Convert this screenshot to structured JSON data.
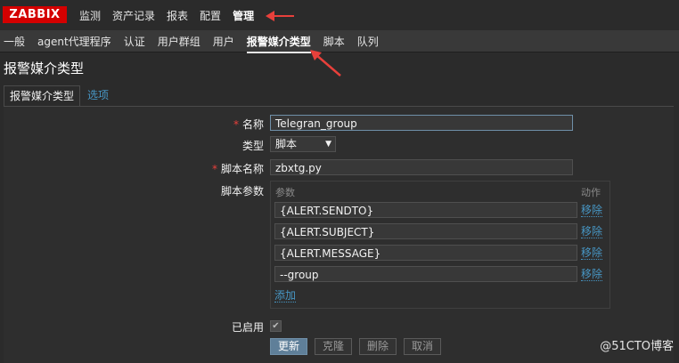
{
  "logo": "ZABBIX",
  "main_menu": [
    "监测",
    "资产记录",
    "报表",
    "配置",
    "管理"
  ],
  "sub_menu": [
    "一般",
    "agent代理程序",
    "认证",
    "用户群组",
    "用户",
    "报警媒介类型",
    "脚本",
    "队列"
  ],
  "page_title": "报警媒介类型",
  "tabs": [
    "报警媒介类型",
    "选项"
  ],
  "form": {
    "name_label": "名称",
    "name_value": "Telegran_group",
    "type_label": "类型",
    "type_value": "脚本",
    "script_name_label": "脚本名称",
    "script_name_value": "zbxtg.py",
    "script_params_label": "脚本参数",
    "params_header": "参数",
    "action_header": "动作",
    "params": [
      {
        "value": "{ALERT.SENDTO}",
        "remove": "移除"
      },
      {
        "value": "{ALERT.SUBJECT}",
        "remove": "移除"
      },
      {
        "value": "{ALERT.MESSAGE}",
        "remove": "移除"
      },
      {
        "value": "--group",
        "remove": "移除"
      }
    ],
    "add_label": "添加",
    "enabled_label": "已启用",
    "enabled_check": "✔"
  },
  "buttons": {
    "update": "更新",
    "clone": "克隆",
    "delete": "删除",
    "cancel": "取消"
  },
  "required_mark": "*",
  "select_arrow": "▼",
  "watermark": "@51CTO博客",
  "colors": {
    "accent_red": "#d40000",
    "link": "#4796c4",
    "arrow": "#e8403b"
  }
}
